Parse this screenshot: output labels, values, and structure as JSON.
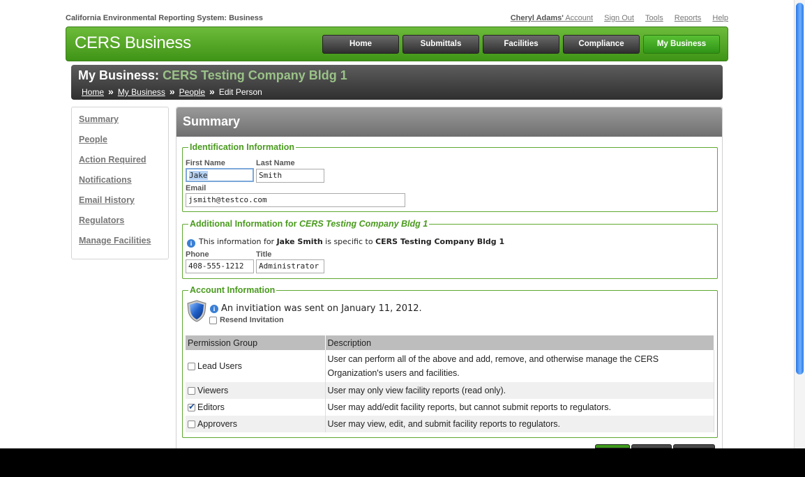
{
  "topbar": {
    "system_name": "California Environmental Reporting System: Business",
    "user_name": "Cheryl Adams'",
    "account": "Account",
    "sign_out": "Sign Out",
    "tools": "Tools",
    "reports": "Reports",
    "help": "Help"
  },
  "header": {
    "brand": "CERS Business",
    "nav": [
      "Home",
      "Submittals",
      "Facilities",
      "Compliance",
      "My Business"
    ],
    "active_nav": "My Business"
  },
  "page_title": {
    "prefix": "My Business:",
    "business": "CERS Testing Company Bldg 1",
    "breadcrumb": [
      "Home",
      "My Business",
      "People"
    ],
    "current": "Edit Person"
  },
  "sidebar": [
    "Summary",
    "People",
    "Action Required",
    "Notifications",
    "Email History",
    "Regulators",
    "Manage Facilities"
  ],
  "main": {
    "title": "Summary",
    "identification": {
      "legend": "Identification Information",
      "first_name_label": "First Name",
      "first_name": "Jake",
      "last_name_label": "Last Name",
      "last_name": "Smith",
      "email_label": "Email",
      "email": "jsmith@testco.com"
    },
    "additional": {
      "legend_prefix": "Additional Information for",
      "legend_business": "CERS Testing Company Bldg 1",
      "note_prefix": "This information for",
      "note_person": "Jake Smith",
      "note_middle": "is specific to",
      "note_business": "CERS Testing Company Bldg 1",
      "phone_label": "Phone",
      "phone": "408-555-1212",
      "title_label": "Title",
      "title": "Administrator"
    },
    "account": {
      "legend": "Account Information",
      "invitation": "An invitiation was sent on January 11, 2012.",
      "resend": "Resend Invitation",
      "columns": [
        "Permission Group",
        "Description"
      ],
      "groups": [
        {
          "name": "Lead Users",
          "checked": false,
          "description": "User can perform all of the above and add, remove, and otherwise manage the CERS Organization's users and facilities."
        },
        {
          "name": "Viewers",
          "checked": false,
          "description": "User may only view facility reports (read only)."
        },
        {
          "name": "Editors",
          "checked": true,
          "description": "User may add/edit facility reports, but cannot submit reports to regulators."
        },
        {
          "name": "Approvers",
          "checked": false,
          "description": "User may view, edit, and submit facility reports to regulators."
        }
      ]
    }
  },
  "colors": {
    "header_green": "#4fa524",
    "legend_green": "#4a9a1e",
    "dark_bar": "#3a3a3a"
  }
}
